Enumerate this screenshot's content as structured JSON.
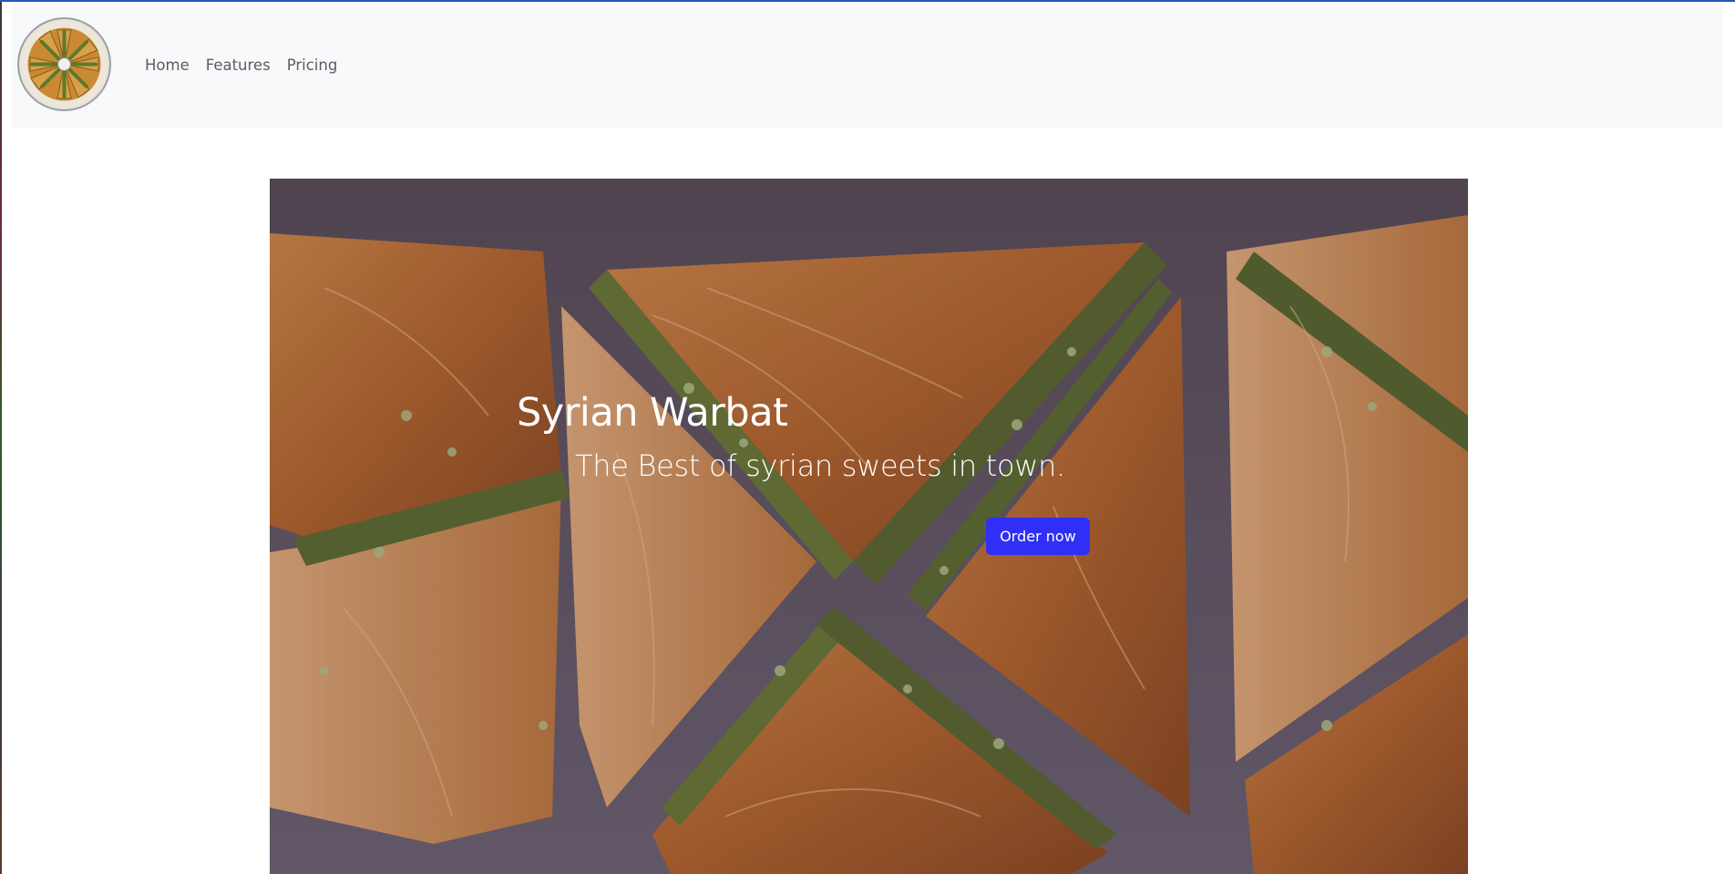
{
  "navbar": {
    "logo_alt": "Syrian Warbat logo",
    "links": [
      {
        "label": "Home"
      },
      {
        "label": "Features"
      },
      {
        "label": "Pricing"
      }
    ]
  },
  "hero": {
    "title": "Syrian Warbat",
    "subtitle": "The Best of syrian sweets in town.",
    "cta_label": "Order now",
    "image_alt": "Tray of warbat pastries with pistachio filling"
  },
  "colors": {
    "top_accent": "#2457b8",
    "navbar_bg": "#f8f9fa",
    "nav_link": "#5a5d61",
    "cta_bg": "#2f2ff5",
    "hero_text": "#ffffff"
  }
}
